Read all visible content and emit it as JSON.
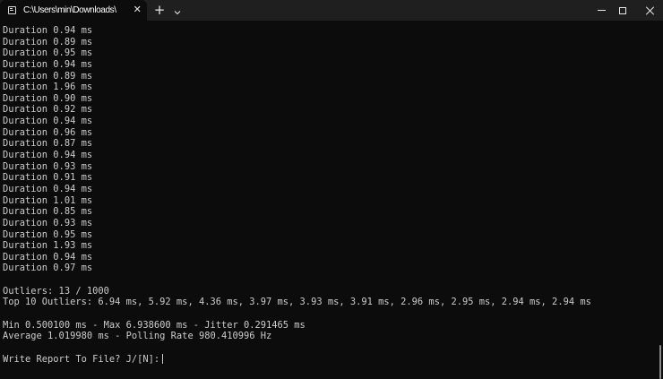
{
  "tab": {
    "title": "C:\\Users\\min\\Downloads\\",
    "close_glyph": "✕",
    "new_tab_glyph": "+",
    "dropdown_glyph": "⌄"
  },
  "window_controls": [
    "minimize",
    "maximize",
    "close"
  ],
  "terminal": {
    "durations": [
      "Duration 0.94 ms",
      "Duration 0.89 ms",
      "Duration 0.95 ms",
      "Duration 0.94 ms",
      "Duration 0.89 ms",
      "Duration 1.96 ms",
      "Duration 0.90 ms",
      "Duration 0.92 ms",
      "Duration 0.94 ms",
      "Duration 0.96 ms",
      "Duration 0.87 ms",
      "Duration 0.94 ms",
      "Duration 0.93 ms",
      "Duration 0.91 ms",
      "Duration 0.94 ms",
      "Duration 1.01 ms",
      "Duration 0.85 ms",
      "Duration 0.93 ms",
      "Duration 0.95 ms",
      "Duration 1.93 ms",
      "Duration 0.94 ms",
      "Duration 0.97 ms"
    ],
    "outliers": "Outliers: 13 / 1000",
    "top_outliers": "Top 10 Outliers: 6.94 ms, 5.92 ms, 4.36 ms, 3.97 ms, 3.93 ms, 3.91 ms, 2.96 ms, 2.95 ms, 2.94 ms, 2.94 ms",
    "min_max_jitter": "Min 0.500100 ms - Max 6.938600 ms - Jitter 0.291465 ms",
    "average": "Average 1.019980 ms - Polling Rate 980.410996 Hz",
    "prompt": "Write Report To File? J/[N]:"
  }
}
